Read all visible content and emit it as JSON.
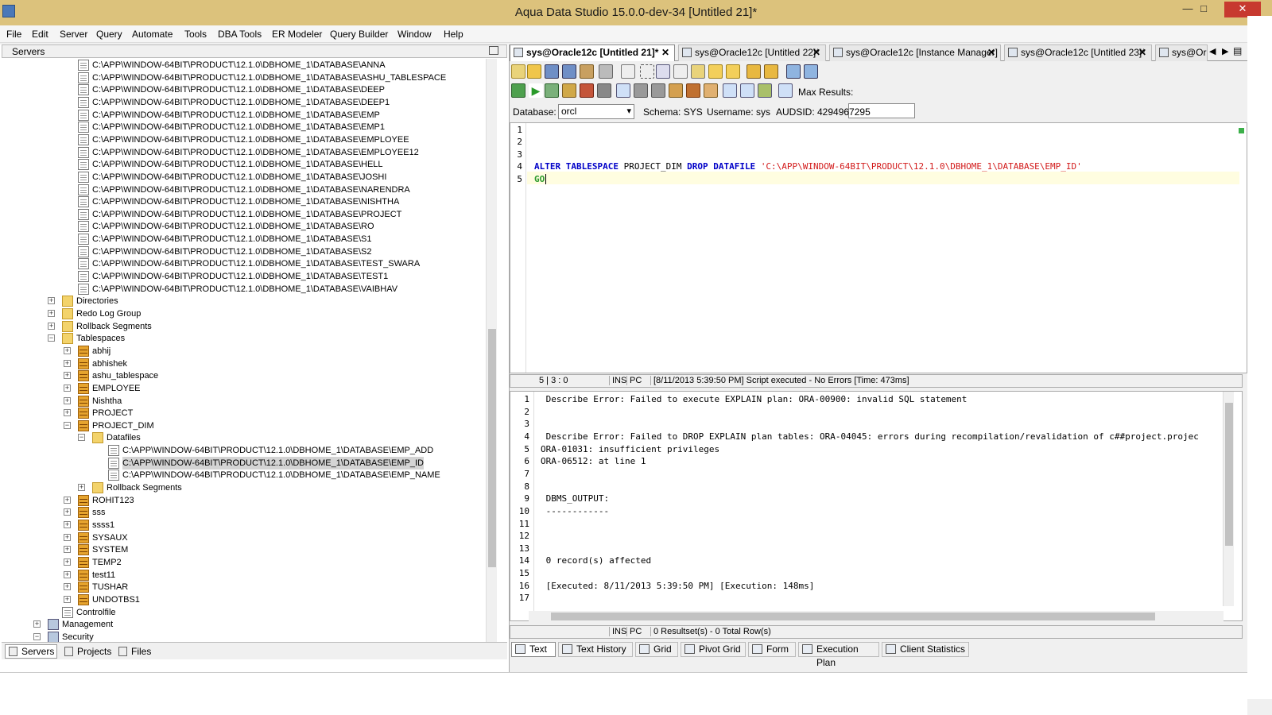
{
  "window": {
    "title": "Aqua Data Studio 15.0.0-dev-34 [Untitled 21]*"
  },
  "menu": [
    "File",
    "Edit",
    "Server",
    "Query",
    "Automate",
    "Tools",
    "DBA Tools",
    "ER Modeler",
    "Query Builder",
    "Window",
    "Help"
  ],
  "left_panel": {
    "header": "Servers",
    "datafile_paths": [
      "C:\\APP\\WINDOW-64BIT\\PRODUCT\\12.1.0\\DBHOME_1\\DATABASE\\ANNA",
      "C:\\APP\\WINDOW-64BIT\\PRODUCT\\12.1.0\\DBHOME_1\\DATABASE\\ASHU_TABLESPACE",
      "C:\\APP\\WINDOW-64BIT\\PRODUCT\\12.1.0\\DBHOME_1\\DATABASE\\DEEP",
      "C:\\APP\\WINDOW-64BIT\\PRODUCT\\12.1.0\\DBHOME_1\\DATABASE\\DEEP1",
      "C:\\APP\\WINDOW-64BIT\\PRODUCT\\12.1.0\\DBHOME_1\\DATABASE\\EMP",
      "C:\\APP\\WINDOW-64BIT\\PRODUCT\\12.1.0\\DBHOME_1\\DATABASE\\EMP1",
      "C:\\APP\\WINDOW-64BIT\\PRODUCT\\12.1.0\\DBHOME_1\\DATABASE\\EMPLOYEE",
      "C:\\APP\\WINDOW-64BIT\\PRODUCT\\12.1.0\\DBHOME_1\\DATABASE\\EMPLOYEE12",
      "C:\\APP\\WINDOW-64BIT\\PRODUCT\\12.1.0\\DBHOME_1\\DATABASE\\HELL",
      "C:\\APP\\WINDOW-64BIT\\PRODUCT\\12.1.0\\DBHOME_1\\DATABASE\\JOSHI",
      "C:\\APP\\WINDOW-64BIT\\PRODUCT\\12.1.0\\DBHOME_1\\DATABASE\\NARENDRA",
      "C:\\APP\\WINDOW-64BIT\\PRODUCT\\12.1.0\\DBHOME_1\\DATABASE\\NISHTHA",
      "C:\\APP\\WINDOW-64BIT\\PRODUCT\\12.1.0\\DBHOME_1\\DATABASE\\PROJECT",
      "C:\\APP\\WINDOW-64BIT\\PRODUCT\\12.1.0\\DBHOME_1\\DATABASE\\RO",
      "C:\\APP\\WINDOW-64BIT\\PRODUCT\\12.1.0\\DBHOME_1\\DATABASE\\S1",
      "C:\\APP\\WINDOW-64BIT\\PRODUCT\\12.1.0\\DBHOME_1\\DATABASE\\S2",
      "C:\\APP\\WINDOW-64BIT\\PRODUCT\\12.1.0\\DBHOME_1\\DATABASE\\TEST_SWARA",
      "C:\\APP\\WINDOW-64BIT\\PRODUCT\\12.1.0\\DBHOME_1\\DATABASE\\TEST1",
      "C:\\APP\\WINDOW-64BIT\\PRODUCT\\12.1.0\\DBHOME_1\\DATABASE\\VAIBHAV"
    ],
    "folders": [
      "Directories",
      "Redo Log Group",
      "Rollback Segments",
      "Tablespaces"
    ],
    "tablespaces_a": [
      "abhij",
      "abhishek",
      "ashu_tablespace",
      "EMPLOYEE",
      "Nishtha",
      "PROJECT",
      "PROJECT_DIM"
    ],
    "datafiles_label": "Datafiles",
    "project_dim_files": [
      "C:\\APP\\WINDOW-64BIT\\PRODUCT\\12.1.0\\DBHOME_1\\DATABASE\\EMP_ADD",
      "C:\\APP\\WINDOW-64BIT\\PRODUCT\\12.1.0\\DBHOME_1\\DATABASE\\EMP_ID",
      "C:\\APP\\WINDOW-64BIT\\PRODUCT\\12.1.0\\DBHOME_1\\DATABASE\\EMP_NAME"
    ],
    "rollback_segments_label": "Rollback Segments",
    "tablespaces_b": [
      "ROHIT123",
      "sss",
      "ssss1",
      "SYSAUX",
      "SYSTEM",
      "TEMP2",
      "test11",
      "TUSHAR",
      "UNDOTBS1"
    ],
    "controlfile_label": "Controlfile",
    "management_label": "Management",
    "security_label": "Security",
    "tabs": [
      "Servers",
      "Projects",
      "Files"
    ]
  },
  "doc_tabs": [
    "sys@Oracle12c [Untitled 21]*",
    "sys@Oracle12c [Untitled 22]*",
    "sys@Oracle12c [Instance Manager]",
    "sys@Oracle12c [Untitled 23]*",
    "sys@Or"
  ],
  "toolbar": {
    "max_results_label": "Max Results:",
    "max_results_value": ""
  },
  "db_row": {
    "database_label": "Database:",
    "database_value": "orcl",
    "schema": "Schema:  SYS",
    "username": "Username:  sys",
    "audsid": "AUDSID:  4294967295"
  },
  "editor": {
    "line_numbers": [
      "1",
      "2",
      "3",
      "4",
      "5"
    ],
    "line4": {
      "kw1": "ALTER",
      "kw2": "TABLESPACE",
      "ident": " PROJECT_DIM ",
      "kw3": "DROP",
      "kw4": "DATAFILE",
      "str": "'C:\\APP\\WINDOW-64BIT\\PRODUCT\\12.1.0\\DBHOME_1\\DATABASE\\EMP_ID'"
    },
    "line5": "GO"
  },
  "editor_status": {
    "pos": "5 | 3 : 0",
    "ins": "INS",
    "pc": "PC",
    "msg": "[8/11/2013 5:39:50 PM] Script executed - No Errors [Time: 473ms]"
  },
  "results": {
    "line_numbers": [
      "1",
      "2",
      "3",
      "4",
      "5",
      "6",
      "7",
      "8",
      "9",
      "10",
      "11",
      "12",
      "13",
      "14",
      "15",
      "16",
      "17"
    ],
    "lines": [
      " Describe Error: Failed to execute EXPLAIN plan: ORA-00900: invalid SQL statement",
      "",
      "",
      " Describe Error: Failed to DROP EXPLAIN plan tables: ORA-04045: errors during recompilation/revalidation of c##project.projec",
      "ORA-01031: insufficient privileges",
      "ORA-06512: at line 1",
      "",
      "",
      " DBMS_OUTPUT:",
      " ------------",
      "",
      "",
      "",
      " 0 record(s) affected",
      "",
      " [Executed: 8/11/2013 5:39:50 PM] [Execution: 148ms]",
      ""
    ]
  },
  "results_status": {
    "ins": "INS",
    "pc": "PC",
    "msg": "0 Resultset(s) - 0 Total Row(s)"
  },
  "result_tabs": [
    "Text",
    "Text History",
    "Grid",
    "Pivot Grid",
    "Form",
    "Execution Plan",
    "Client Statistics"
  ]
}
